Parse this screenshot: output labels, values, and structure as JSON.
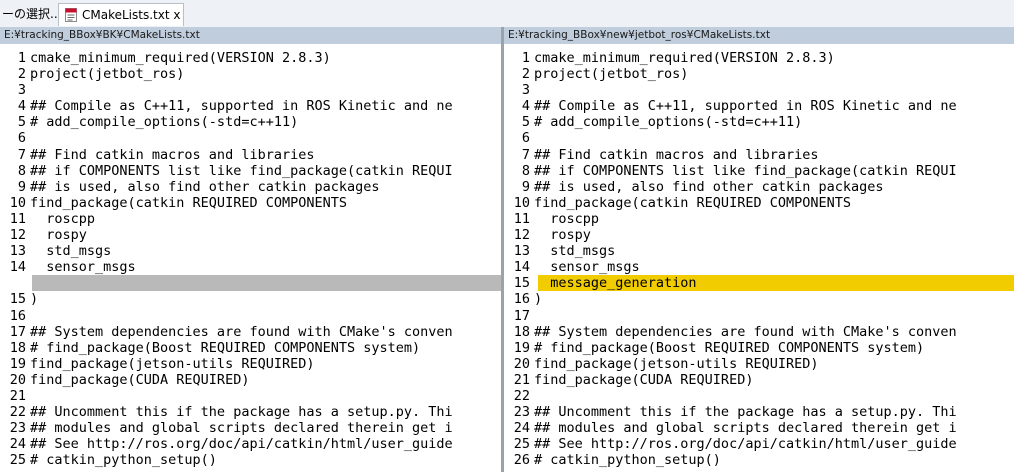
{
  "tabs": [
    {
      "label": "ーの選択..."
    },
    {
      "label": "CMakeLists.txt x 2"
    }
  ],
  "left": {
    "path": "E:¥tracking_BBox¥BK¥CMakeLists.txt",
    "lines": [
      {
        "n": "1",
        "t": "cmake_minimum_required(VERSION 2.8.3)"
      },
      {
        "n": "2",
        "t": "project(jetbot_ros)"
      },
      {
        "n": "3",
        "t": ""
      },
      {
        "n": "4",
        "t": "## Compile as C++11, supported in ROS Kinetic and ne"
      },
      {
        "n": "5",
        "t": "# add_compile_options(-std=c++11)"
      },
      {
        "n": "6",
        "t": ""
      },
      {
        "n": "7",
        "t": "## Find catkin macros and libraries"
      },
      {
        "n": "8",
        "t": "## if COMPONENTS list like find_package(catkin REQUI"
      },
      {
        "n": "9",
        "t": "## is used, also find other catkin packages"
      },
      {
        "n": "10",
        "t": "find_package(catkin REQUIRED COMPONENTS"
      },
      {
        "n": "11",
        "t": "  roscpp"
      },
      {
        "n": "12",
        "t": "  rospy"
      },
      {
        "n": "13",
        "t": "  std_msgs"
      },
      {
        "n": "14",
        "t": "  sensor_msgs",
        "gap": true
      },
      {
        "n": "15",
        "t": ")"
      },
      {
        "n": "16",
        "t": ""
      },
      {
        "n": "17",
        "t": "## System dependencies are found with CMake's conven"
      },
      {
        "n": "18",
        "t": "# find_package(Boost REQUIRED COMPONENTS system)"
      },
      {
        "n": "19",
        "t": "find_package(jetson-utils REQUIRED)"
      },
      {
        "n": "20",
        "t": "find_package(CUDA REQUIRED)"
      },
      {
        "n": "21",
        "t": ""
      },
      {
        "n": "22",
        "t": "## Uncomment this if the package has a setup.py. Thi"
      },
      {
        "n": "23",
        "t": "## modules and global scripts declared therein get i"
      },
      {
        "n": "24",
        "t": "## See http://ros.org/doc/api/catkin/html/user_guide"
      },
      {
        "n": "25",
        "t": "# catkin_python_setup()"
      }
    ]
  },
  "right": {
    "path": "E:¥tracking_BBox¥new¥jetbot_ros¥CMakeLists.txt",
    "lines": [
      {
        "n": "1",
        "t": "cmake_minimum_required(VERSION 2.8.3)"
      },
      {
        "n": "2",
        "t": "project(jetbot_ros)"
      },
      {
        "n": "3",
        "t": ""
      },
      {
        "n": "4",
        "t": "## Compile as C++11, supported in ROS Kinetic and ne"
      },
      {
        "n": "5",
        "t": "# add_compile_options(-std=c++11)"
      },
      {
        "n": "6",
        "t": ""
      },
      {
        "n": "7",
        "t": "## Find catkin macros and libraries"
      },
      {
        "n": "8",
        "t": "## if COMPONENTS list like find_package(catkin REQUI"
      },
      {
        "n": "9",
        "t": "## is used, also find other catkin packages"
      },
      {
        "n": "10",
        "t": "find_package(catkin REQUIRED COMPONENTS"
      },
      {
        "n": "11",
        "t": "  roscpp"
      },
      {
        "n": "12",
        "t": "  rospy"
      },
      {
        "n": "13",
        "t": "  std_msgs"
      },
      {
        "n": "14",
        "t": "  sensor_msgs"
      },
      {
        "n": "15",
        "t": "  message_generation",
        "added": true
      },
      {
        "n": "16",
        "t": ")"
      },
      {
        "n": "17",
        "t": ""
      },
      {
        "n": "18",
        "t": "## System dependencies are found with CMake's conven"
      },
      {
        "n": "19",
        "t": "# find_package(Boost REQUIRED COMPONENTS system)"
      },
      {
        "n": "20",
        "t": "find_package(jetson-utils REQUIRED)"
      },
      {
        "n": "21",
        "t": "find_package(CUDA REQUIRED)"
      },
      {
        "n": "22",
        "t": ""
      },
      {
        "n": "23",
        "t": "## Uncomment this if the package has a setup.py. Thi"
      },
      {
        "n": "24",
        "t": "## modules and global scripts declared therein get i"
      },
      {
        "n": "25",
        "t": "## See http://ros.org/doc/api/catkin/html/user_guide"
      },
      {
        "n": "26",
        "t": "# catkin_python_setup()"
      }
    ]
  },
  "colors": {
    "added_highlight": "#f0cc00",
    "missing_highlight": "#b9b9b9",
    "path_bar": "#c0cddc"
  },
  "icons": {
    "tab_file": "text-file-icon"
  }
}
